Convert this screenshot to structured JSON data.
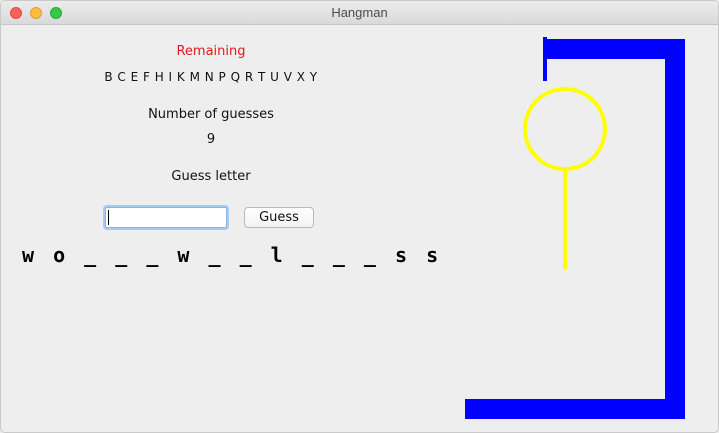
{
  "window": {
    "title": "Hangman"
  },
  "remaining": {
    "label": "Remaining",
    "letters": "B C E F H I K M N P Q R T U V X Y"
  },
  "guesses": {
    "label": "Number of guesses",
    "count": "9"
  },
  "guess_letter": {
    "label": "Guess letter",
    "input_value": "",
    "button_label": "Guess"
  },
  "word": {
    "display": "w o _ _ _ w _ _ l _ _ _ s s"
  },
  "colors": {
    "remaining_label": "#e61919",
    "gallows": "#0000ff",
    "figure": "#ffff00"
  },
  "figure": {
    "parts_shown": [
      "head",
      "body"
    ]
  }
}
